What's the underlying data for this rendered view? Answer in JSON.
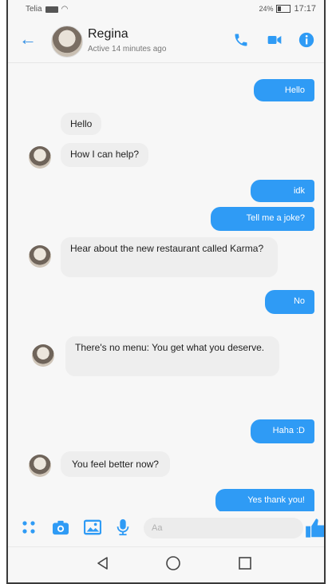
{
  "status": {
    "carrier": "Telia",
    "battery": "24%",
    "time": "17:17"
  },
  "header": {
    "name": "Regina",
    "active": "Active 14 minutes ago"
  },
  "colors": {
    "accent": "#2f9bf5",
    "incoming_bubble": "#eeeeee"
  },
  "messages": [
    {
      "from": "me",
      "text": "Hello"
    },
    {
      "from": "them",
      "text": "Hello"
    },
    {
      "from": "them",
      "text": "How I can help?"
    },
    {
      "from": "me",
      "text": "idk"
    },
    {
      "from": "me",
      "text": "Tell me a joke?"
    },
    {
      "from": "them",
      "text": "Hear about the new restaurant called Karma?"
    },
    {
      "from": "me",
      "text": "No"
    },
    {
      "from": "them",
      "text": "There's no menu: You get what you deserve."
    },
    {
      "from": "me",
      "text": "Haha :D"
    },
    {
      "from": "them",
      "text": "You feel better now?"
    },
    {
      "from": "me",
      "text": "Yes thank you!"
    }
  ],
  "composer": {
    "placeholder": "Aa"
  },
  "icons": {
    "header": [
      "back-arrow-icon",
      "phone-icon",
      "video-camera-icon",
      "info-icon"
    ],
    "composer": [
      "apps-grid-icon",
      "camera-icon",
      "image-icon",
      "microphone-icon",
      "thumbs-up-icon"
    ],
    "nav": [
      "back-triangle-icon",
      "home-circle-icon",
      "recents-square-icon"
    ]
  }
}
